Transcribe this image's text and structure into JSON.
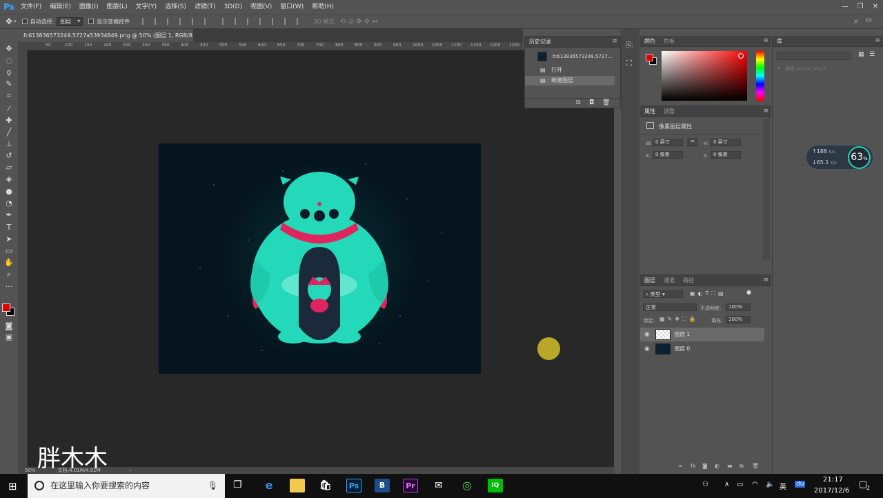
{
  "app": {
    "logo": "Ps",
    "menu": [
      "文件(F)",
      "编辑(E)",
      "图像(I)",
      "图层(L)",
      "文字(Y)",
      "选择(S)",
      "滤镜(T)",
      "3D(D)",
      "视图(V)",
      "窗口(W)",
      "帮助(H)"
    ],
    "window_controls": [
      "—",
      "❐",
      "✕"
    ]
  },
  "options_bar": {
    "auto_select_label": "自动选择:",
    "auto_select_value": "图层",
    "show_transform_label": "显示变换控件",
    "mode_3d": "3D 模式:"
  },
  "document": {
    "tab_title": "fc613836573249.5727a53934849.png @ 50% (图层 1, RGB/8#) *",
    "zoom": "50%",
    "doc_info": "文档:4.01M/4.01M"
  },
  "ruler": {
    "top_ticks": [
      "50",
      "100",
      "150",
      "200",
      "250",
      "300",
      "350",
      "400",
      "450",
      "500",
      "550",
      "600",
      "650",
      "700",
      "750",
      "800",
      "850",
      "900",
      "950",
      "1000",
      "1050",
      "1100",
      "1150",
      "1200",
      "1250",
      "1300",
      "1350",
      "1400",
      "1450",
      "1500",
      "1550"
    ]
  },
  "history": {
    "tab": "历史记录",
    "snapshot": "fc613836573249.5727...",
    "items": [
      "打开",
      "新建图层"
    ]
  },
  "color": {
    "tabs": [
      "颜色",
      "色板"
    ],
    "foreground": "#e00000",
    "background": "#000000"
  },
  "properties": {
    "tabs": [
      "属性",
      "调整"
    ],
    "title": "像素图层属性",
    "w_label": "W:",
    "w_value": "0 英寸",
    "h_label": "H:",
    "h_value": "0 英寸",
    "x_label": "X:",
    "x_value": "0 像素",
    "y_label": "Y:",
    "y_value": "0 像素"
  },
  "layers": {
    "tabs": [
      "图层",
      "通道",
      "路径"
    ],
    "filter": "类型",
    "blend_mode": "正常",
    "opacity_label": "不透明度:",
    "opacity": "100%",
    "lock_label": "锁定:",
    "fill_label": "填充:",
    "fill": "100%",
    "items": [
      "图层 1",
      "图层 0"
    ]
  },
  "library": {
    "tab": "库",
    "search_placeholder": "搜索 Adobe Stock"
  },
  "speed_widget": {
    "up": "188",
    "up_unit": "K/s",
    "down": "65.1",
    "down_unit": "K/s",
    "percent": "63",
    "percent_unit": "%"
  },
  "watermark": "胖木木",
  "taskbar": {
    "search_placeholder": "在这里输入你要搜索的内容",
    "apps": [
      "B",
      "Pr",
      "Ps"
    ],
    "ime": "英",
    "baidu": "du",
    "time": "21:17",
    "date": "2017/12/6",
    "notifications": "2"
  }
}
